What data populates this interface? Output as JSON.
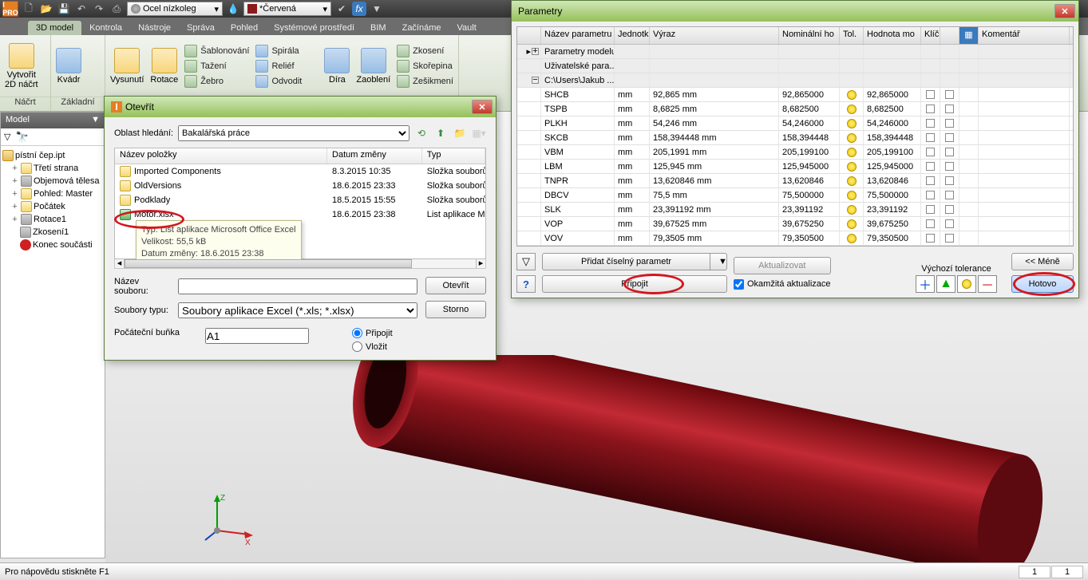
{
  "top": {
    "material_label": "Ocel nízkoleg",
    "appearance_label": "*Červená",
    "appearance_swatch": "#8B1A1A"
  },
  "ribbon": {
    "tabs": [
      "3D model",
      "Kontrola",
      "Nástroje",
      "Správa",
      "Pohled",
      "Systémové prostředí",
      "BIM",
      "Začínáme",
      "Vault"
    ],
    "active": 0,
    "panel_nacrt": "Náčrt",
    "btn_create2d": "Vytvořit\n2D náčrt",
    "panel_primitives": "Základní",
    "btn_kvadr": "Kvádr",
    "btn_vysunuti": "Vysunutí",
    "btn_rotace": "Rotace",
    "txt_sablonovani": "Šablonování",
    "txt_tazeni": "Tažení",
    "txt_zebro": "Žebro",
    "txt_spirala": "Spirála",
    "txt_relief": "Reliéf",
    "txt_odvodit": "Odvodit",
    "btn_dira": "Díra",
    "btn_zaobleni": "Zaoblení",
    "txt_zkoseni": "Zkosení",
    "txt_skorepina": "Skořepina",
    "txt_zesikmeni": "Zešikmení"
  },
  "model": {
    "header": "Model",
    "root": "pístní čep.ipt",
    "items": [
      "Třetí strana",
      "Objemová tělesa",
      "Pohled: Master",
      "Počátek",
      "Rotace1",
      "Zkosení1",
      "Konec součásti"
    ]
  },
  "open_dialog": {
    "title": "Otevřít",
    "lbl_lookin": "Oblast hledání:",
    "folder": "Bakalářská práce",
    "col_name": "Název položky",
    "col_date": "Datum změny",
    "col_type": "Typ",
    "files": [
      {
        "name": "Imported Components",
        "date": "8.3.2015 10:35",
        "type": "Složka souborů",
        "kind": "folder"
      },
      {
        "name": "OldVersions",
        "date": "18.6.2015 23:33",
        "type": "Složka souborů",
        "kind": "folder"
      },
      {
        "name": "Podklady",
        "date": "18.5.2015 15:55",
        "type": "Složka souborů",
        "kind": "folder"
      },
      {
        "name": "Motor.xlsx",
        "date": "18.6.2015 23:38",
        "type": "List aplikace M",
        "kind": "xlsx"
      }
    ],
    "tooltip_l1": "Typ: List aplikace Microsoft Office Excel",
    "tooltip_l2": "Velikost: 55,5 kB",
    "tooltip_l3": "Datum změny: 18.6.2015 23:38",
    "lbl_filename": "Název\nsouboru:",
    "lbl_filetype": "Soubory typu:",
    "filetype": "Soubory aplikace Excel (*.xls; *.xlsx)",
    "btn_open": "Otevřít",
    "btn_cancel": "Storno",
    "lbl_startcell": "Počáteční buňka",
    "startcell": "A1",
    "radio_link": "Připojit",
    "radio_embed": "Vložit"
  },
  "param_dialog": {
    "title": "Parametry",
    "hdr_name": "Název parametru",
    "hdr_unit": "Jednotk",
    "hdr_expr": "Výraz",
    "hdr_nom": "Nominální ho",
    "hdr_tol": "Tol.",
    "hdr_mod": "Hodnota mo",
    "hdr_key": "Klíč",
    "hdr_com": "Komentář",
    "group_model": "Parametry modelu",
    "group_user": "Uživatelské para...",
    "group_path": "C:\\Users\\Jakub ...",
    "rows": [
      {
        "n": "SHCB",
        "u": "mm",
        "e": "92,865 mm",
        "nom": "92,865000",
        "mod": "92,865000"
      },
      {
        "n": "TSPB",
        "u": "mm",
        "e": "8,6825 mm",
        "nom": "8,682500",
        "mod": "8,682500"
      },
      {
        "n": "PLKH",
        "u": "mm",
        "e": "54,246 mm",
        "nom": "54,246000",
        "mod": "54,246000"
      },
      {
        "n": "SKCB",
        "u": "mm",
        "e": "158,394448 mm",
        "nom": "158,394448",
        "mod": "158,394448"
      },
      {
        "n": "VBM",
        "u": "mm",
        "e": "205,1991 mm",
        "nom": "205,199100",
        "mod": "205,199100"
      },
      {
        "n": "LBM",
        "u": "mm",
        "e": "125,945 mm",
        "nom": "125,945000",
        "mod": "125,945000"
      },
      {
        "n": "TNPR",
        "u": "mm",
        "e": "13,620846 mm",
        "nom": "13,620846",
        "mod": "13,620846"
      },
      {
        "n": "DBCV",
        "u": "mm",
        "e": "75,5 mm",
        "nom": "75,500000",
        "mod": "75,500000"
      },
      {
        "n": "SLK",
        "u": "mm",
        "e": "23,391192 mm",
        "nom": "23,391192",
        "mod": "23,391192"
      },
      {
        "n": "VOP",
        "u": "mm",
        "e": "39,67525 mm",
        "nom": "39,675250",
        "mod": "39,675250"
      },
      {
        "n": "VOV",
        "u": "mm",
        "e": "79,3505 mm",
        "nom": "79,350500",
        "mod": "79,350500"
      }
    ],
    "btn_addnum": "Přidat číselný parametr",
    "btn_update": "Aktualizovat",
    "btn_link": "Připojit",
    "chk_immediate": "Okamžitá aktualizace",
    "lbl_deftol": "Výchozí tolerance",
    "btn_less": "<< Méně",
    "btn_done": "Hotovo"
  },
  "status": {
    "text": "Pro nápovědu stiskněte F1",
    "c1": "1",
    "c2": "1"
  }
}
